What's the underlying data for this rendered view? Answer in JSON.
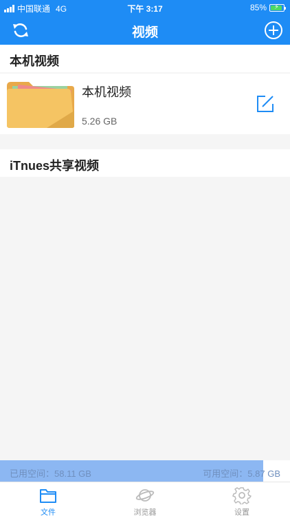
{
  "status_bar": {
    "carrier": "中国联通",
    "network": "4G",
    "time": "下午 3:17",
    "battery": "85%"
  },
  "nav": {
    "title": "视频",
    "left_icon": "refresh-icon",
    "right_icon": "add-circle-icon"
  },
  "local_section": {
    "title": "本机视频",
    "items": [
      {
        "name": "本机视频",
        "size": "5.26 GB",
        "icon": "folder-icon"
      }
    ]
  },
  "itunes_section": {
    "title": "iTnues共享视频"
  },
  "storage": {
    "used_label": "已用空间：58.11 GB",
    "avail_label": "可用空间：5.87 GB",
    "used_fraction": 0.908
  },
  "tabs": [
    {
      "label": "文件",
      "icon": "folder-icon",
      "active": true
    },
    {
      "label": "浏览器",
      "icon": "planet-icon",
      "active": false
    },
    {
      "label": "设置",
      "icon": "gear-icon",
      "active": false
    }
  ],
  "colors": {
    "primary": "#1e8cf5",
    "storage_bar": "#8cb7f2",
    "folder": "#f5c463"
  }
}
